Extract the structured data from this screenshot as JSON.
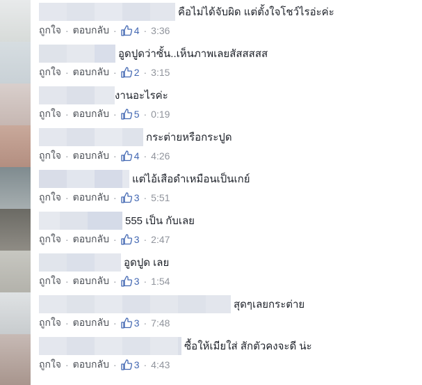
{
  "colors": {
    "link": "#4267b2",
    "text": "#1d2129",
    "meta": "#4b4f56",
    "time": "#90949c",
    "blur": "#dde2ec"
  },
  "actions": {
    "like": "ถูกใจ",
    "reply": "ตอบกลับ",
    "separator": "·"
  },
  "comments": [
    {
      "text": "คือไม่ได้จับผิด แต่ตั้งใจโชว์ไรอ่ะค่ะ",
      "likes": "4",
      "time": "3:36"
    },
    {
      "text": "อูดปูดว่าซั้น..เห็นภาพเลยสัสสสสส",
      "likes": "2",
      "time": "3:15"
    },
    {
      "text": "งานอะไรค่ะ",
      "likes": "5",
      "time": "0:19"
    },
    {
      "text": "กระต่ายหรือกระปูด",
      "likes": "4",
      "time": "4:26"
    },
    {
      "text": "แต่ไอ้เสือดำเหมือนเป็นเกย์",
      "likes": "3",
      "time": "5:51"
    },
    {
      "text": "555 เป็น กับเลย",
      "likes": "3",
      "time": "2:47"
    },
    {
      "text": "อูดปูด เลย",
      "likes": "3",
      "time": "1:54"
    },
    {
      "text": "สุดๆเลยกระต่าย",
      "likes": "3",
      "time": "7:48"
    },
    {
      "text": "ซื้อให้เมียใส่ สักตัวคงจะดี น่ะ",
      "likes": "3",
      "time": "4:43"
    }
  ]
}
